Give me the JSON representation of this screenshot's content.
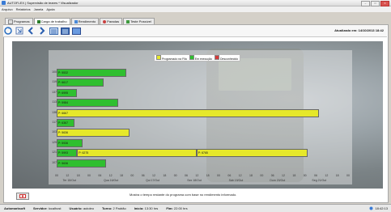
{
  "window": {
    "title": "AUTOFLEX | Supervisão de teares * Visualizador"
  },
  "menu": [
    "Arquivo",
    "Relatórios",
    "Janela",
    "Ajuda"
  ],
  "tabs": [
    {
      "label": "Programas",
      "active": false
    },
    {
      "label": "Carga de trabalho",
      "active": true
    },
    {
      "label": "Rendimento",
      "active": false
    },
    {
      "label": "Paradas",
      "active": false
    },
    {
      "label": "Teste Possível",
      "active": false
    }
  ],
  "toolbar": {
    "updated": "Atualizado em: 14/10/2013 18:42"
  },
  "legend": [
    {
      "label": "Programado na Fila",
      "color": "#e6e82a"
    },
    {
      "label": "Em execução",
      "color": "#2fbf2f"
    },
    {
      "label": "Desconhecido",
      "color": "#d63a3a"
    }
  ],
  "chart_data": {
    "type": "bar",
    "title": "",
    "rows": [
      {
        "machine": "100",
        "bars": [
          {
            "label": "P: 5532",
            "start": 0,
            "end": 0.24,
            "color": "#2fbf2f"
          }
        ]
      },
      {
        "machine": "119",
        "bars": [
          {
            "label": "P: 6617",
            "start": 0,
            "end": 0.16,
            "color": "#2fbf2f"
          }
        ]
      },
      {
        "machine": "137",
        "bars": [
          {
            "label": "P: 6995",
            "start": 0,
            "end": 0.07,
            "color": "#2fbf2f"
          }
        ]
      },
      {
        "machine": "113",
        "bars": [
          {
            "label": "P: 5984",
            "start": 0,
            "end": 0.21,
            "color": "#2fbf2f"
          }
        ]
      },
      {
        "machine": "138",
        "bars": [
          {
            "label": "P: 6667",
            "start": 0,
            "end": 0.9,
            "color": "#e6e82a"
          }
        ]
      },
      {
        "machine": "117",
        "bars": [
          {
            "label": "P: 6367",
            "start": 0,
            "end": 0.06,
            "color": "#2fbf2f"
          }
        ]
      },
      {
        "machine": "103",
        "bars": [
          {
            "label": "P: 5636",
            "start": 0,
            "end": 0.25,
            "color": "#e6e82a"
          }
        ]
      },
      {
        "machine": "129",
        "bars": [
          {
            "label": "P: 5936",
            "start": 0,
            "end": 0.09,
            "color": "#2fbf2f"
          }
        ]
      },
      {
        "machine": "121",
        "bars": [
          {
            "label": "P: 5993",
            "start": 0,
            "end": 0.07,
            "color": "#2fbf2f"
          },
          {
            "label": "P: 6275",
            "start": 0.07,
            "end": 0.48,
            "color": "#e6e82a"
          },
          {
            "label": "P: 6765",
            "start": 0.48,
            "end": 0.86,
            "color": "#e6e82a"
          }
        ]
      },
      {
        "machine": "107",
        "bars": [
          {
            "label": "P: 5636",
            "start": 0,
            "end": 0.17,
            "color": "#2fbf2f"
          }
        ]
      }
    ],
    "x_ticks": [
      "00",
      "12",
      "18",
      "00",
      "06",
      "12",
      "18",
      "00",
      "06",
      "12",
      "18",
      "00",
      "06",
      "12",
      "18",
      "00",
      "06",
      "12",
      "18",
      "00",
      "06",
      "12",
      "18",
      "00",
      "06",
      "12",
      "18",
      "00"
    ],
    "days": [
      "Ter 15/Out",
      "Qua 16/Out",
      "Qui 17/Out",
      "Sex 18/Out",
      "Sáb 19/Out",
      "Dom 20/Out",
      "Seg 21/Out"
    ]
  },
  "note": "Mostra o tempo restante do programa com base no rendimento informado.",
  "statusbar": [
    {
      "key": "Automarksoft",
      "value": ""
    },
    {
      "key": "Servidor:",
      "value": "localhost"
    },
    {
      "key": "Usuário:",
      "value": "autoleo"
    },
    {
      "key": "Turno:",
      "value": "2 Padrão"
    },
    {
      "key": "Início:",
      "value": "13:30 hrs"
    },
    {
      "key": "Fim:",
      "value": "22:00 hrs"
    }
  ],
  "clock": "18:42:13"
}
